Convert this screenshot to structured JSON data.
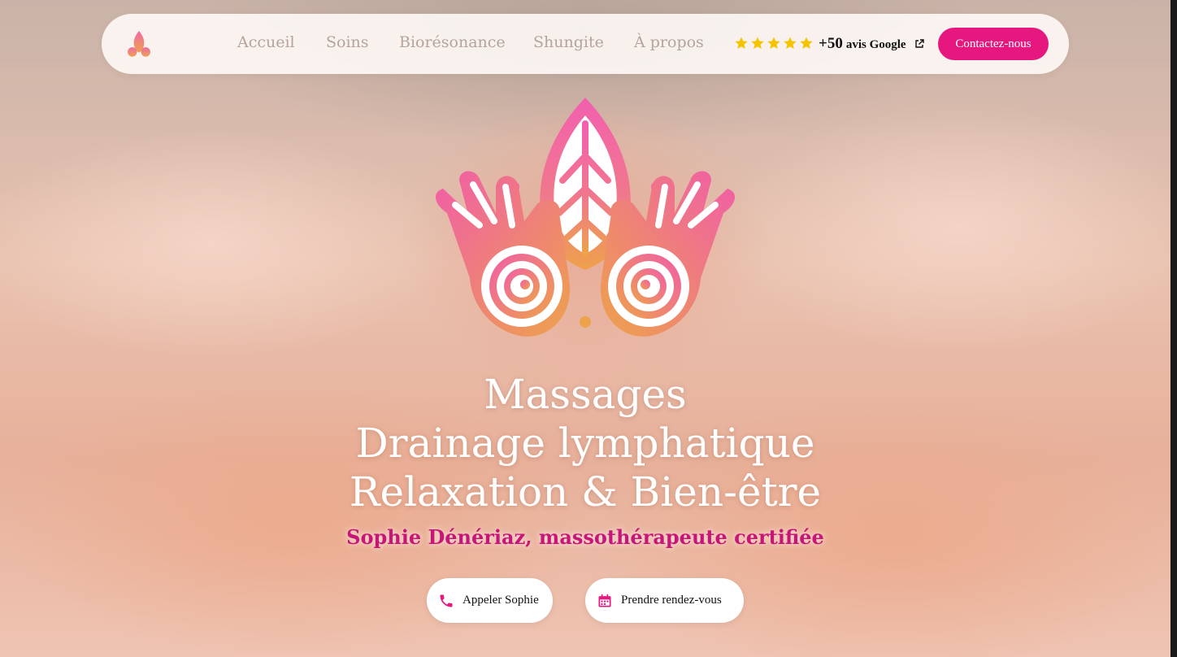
{
  "nav": {
    "items": [
      {
        "label": "Accueil"
      },
      {
        "label": "Soins"
      },
      {
        "label": "Biorésonance"
      },
      {
        "label": "Shungite"
      },
      {
        "label": "À propos"
      }
    ],
    "rating": {
      "stars": 5,
      "count": "+50",
      "label": "avis Google"
    },
    "contact_label": "Contactez-nous"
  },
  "hero": {
    "lines": [
      "Massages",
      "Drainage lymphatique",
      "Relaxation & Bien-être"
    ],
    "subtitle": "Sophie Dénériaz, massothérapeute certifiée",
    "call_label": "Appeler Sophie",
    "book_label": "Prendre rendez-vous"
  },
  "colors": {
    "accent": "#e6187f",
    "subtitle": "#c81678",
    "star": "#f5c400",
    "nav_text": "#b4a49c"
  },
  "icons": {
    "logo": "lotus-hands-logo-icon",
    "phone": "phone-icon",
    "calendar": "calendar-icon",
    "external": "external-link-icon",
    "star": "star-icon"
  }
}
